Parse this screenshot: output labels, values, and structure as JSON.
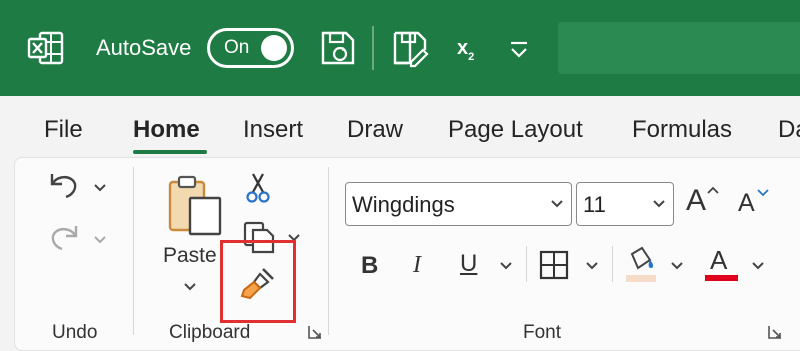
{
  "titlebar": {
    "autosave_label": "AutoSave",
    "autosave_state": "On",
    "subscript_label": "x",
    "subscript_digit": "2",
    "icons": [
      "excel-icon",
      "save-icon",
      "save-edit-icon",
      "subscript-icon",
      "customize-qat-icon"
    ],
    "accent": "#1e7b43"
  },
  "tabs": [
    "File",
    "Home",
    "Insert",
    "Draw",
    "Page Layout",
    "Formulas",
    "Da"
  ],
  "active_tab": "Home",
  "ribbon": {
    "undo_group_label": "Undo",
    "clipboard_group_label": "Clipboard",
    "font_group_label": "Font",
    "paste_label": "Paste",
    "font_name": "Wingdings",
    "font_size": "11",
    "grow_font_glyph": "A",
    "shrink_font_glyph": "A",
    "bold_glyph": "B",
    "italic_glyph": "I",
    "underline_glyph": "U",
    "font_color_glyph": "A",
    "font_color": "#e0001b",
    "highlight_color": "#f6dcc8",
    "highlight_box_color": "#e03030"
  }
}
